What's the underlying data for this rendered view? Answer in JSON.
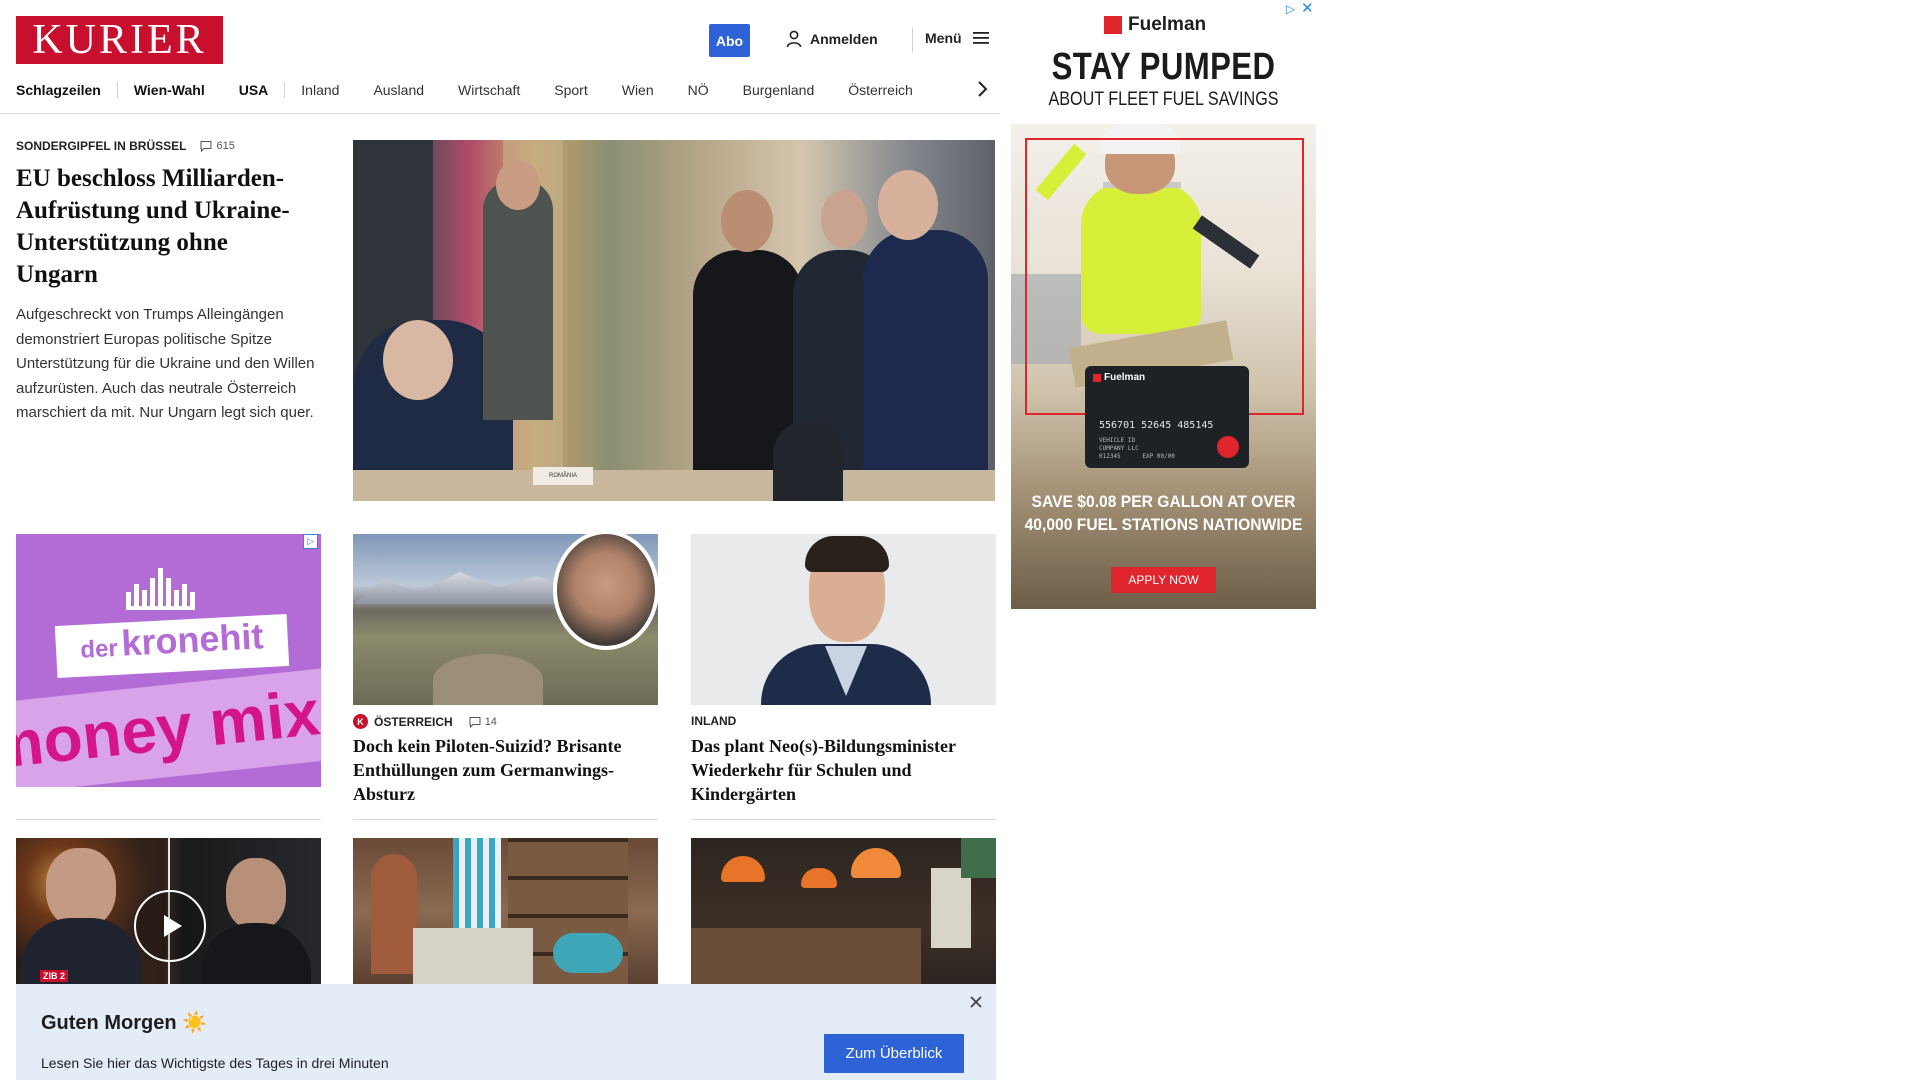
{
  "header": {
    "logo_text": "KURIER",
    "abo_label": "Abo",
    "login_label": "Anmelden",
    "menu_label": "Menü"
  },
  "nav": {
    "items": [
      {
        "label": "Schlagzeilen"
      },
      {
        "label": "Wien-Wahl"
      },
      {
        "label": "USA"
      },
      {
        "label": "Inland"
      },
      {
        "label": "Ausland"
      },
      {
        "label": "Wirtschaft"
      },
      {
        "label": "Sport"
      },
      {
        "label": "Wien"
      },
      {
        "label": "NÖ"
      },
      {
        "label": "Burgenland"
      },
      {
        "label": "Österreich"
      }
    ]
  },
  "lead": {
    "kicker": "Sondergipfel in Brüssel",
    "comments": "615",
    "title": "EU beschloss Milliarden-Aufrüstung und Ukraine-Unterstützung ohne Ungarn",
    "teaser": "Aufgeschreckt von Trumps Alleingängen demonstriert Europas politische Spitze Unterstützung für die Ukraine und den Willen aufzurüsten. Auch das neutrale Österreich marschiert da mit. Nur Ungarn legt sich quer.",
    "photo_caption": "ROMÂNIA"
  },
  "ads": {
    "kronehit": {
      "brand_small": "der",
      "brand_large": "kronehit",
      "slogan": "money mix"
    },
    "fuelman": {
      "brand": "Fuelman",
      "headline": "STAY PUMPED",
      "subline": "ABOUT FLEET FUEL SAVINGS",
      "card_brand": "Fuelman",
      "card_number": "556701 52645 485145",
      "card_line1": "VEHICLE ID",
      "card_line2": "COMPANY LLC",
      "card_line3": "012345      EXP 00/00",
      "offer": "SAVE $0.08 PER GALLON AT OVER 40,000 FUEL STATIONS NATIONWIDE",
      "cta": "APPLY NOW"
    }
  },
  "cards": [
    {
      "kicker": "Österreich",
      "badge": "K",
      "comments": "14",
      "title": "Doch kein Piloten-Suizid? Brisante Enthüllungen zum Germanwings-Absturz"
    },
    {
      "kicker": "Inland",
      "title": "Das plant Neo(s)-Bildungsminister Wiederkehr für Schulen und Kindergärten"
    }
  ],
  "video_card": {
    "badge": "ZIB 2"
  },
  "banner": {
    "title": "Guten Morgen ☀️",
    "text": "Lesen Sie hier das Wichtigste des Tages in drei Minuten",
    "button": "Zum Überblick"
  },
  "colors": {
    "brand_red": "#c8102e",
    "accent_blue": "#2d63d6",
    "banner_bg": "#e4ecf7",
    "kronehit_purple": "#b36bd6"
  }
}
